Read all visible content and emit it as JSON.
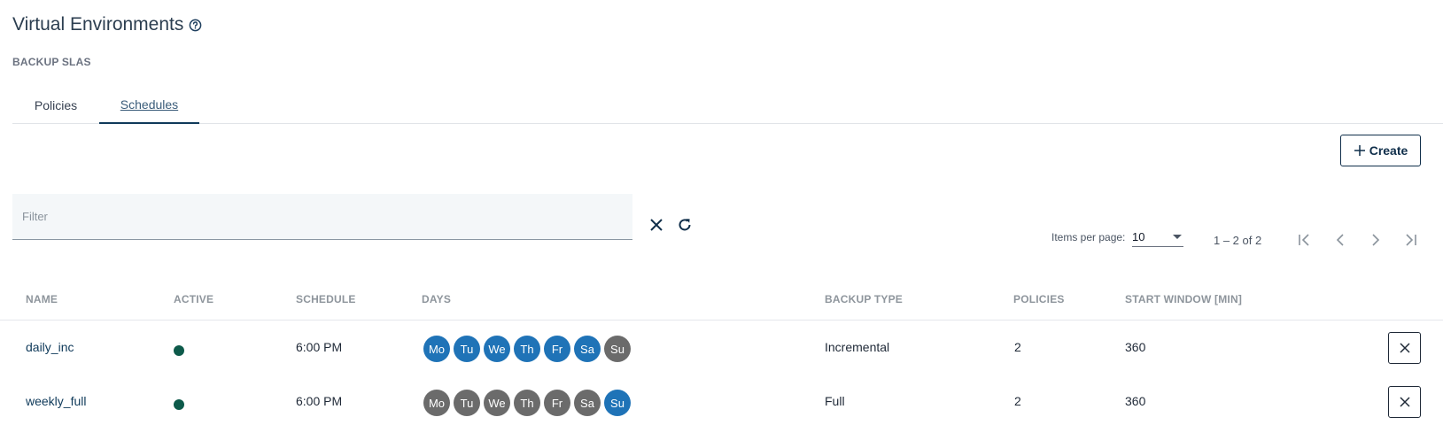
{
  "page": {
    "title": "Virtual Environments",
    "subtitle": "BACKUP SLAS"
  },
  "tabs": [
    {
      "label": "Policies",
      "active": false
    },
    {
      "label": "Schedules",
      "active": true
    }
  ],
  "toolbar": {
    "create_label": "Create"
  },
  "filter": {
    "placeholder": "Filter",
    "value": ""
  },
  "pagination": {
    "items_per_page_label": "Items per page:",
    "items_per_page": "10",
    "range": "1 – 2 of 2"
  },
  "table": {
    "columns": [
      "NAME",
      "ACTIVE",
      "SCHEDULE",
      "DAYS",
      "BACKUP TYPE",
      "POLICIES",
      "START WINDOW [MIN]"
    ],
    "day_labels": [
      "Mo",
      "Tu",
      "We",
      "Th",
      "Fr",
      "Sa",
      "Su"
    ],
    "rows": [
      {
        "name": "daily_inc",
        "active": true,
        "schedule": "6:00 PM",
        "days_on": [
          true,
          true,
          true,
          true,
          true,
          true,
          false
        ],
        "backup_type": "Incremental",
        "policies": "2",
        "start_window": "360"
      },
      {
        "name": "weekly_full",
        "active": true,
        "schedule": "6:00 PM",
        "days_on": [
          false,
          false,
          false,
          false,
          false,
          false,
          true
        ],
        "backup_type": "Full",
        "policies": "2",
        "start_window": "360"
      }
    ]
  },
  "colors": {
    "accent": "#0f3a5a",
    "day_on": "#1f73b7",
    "day_off": "#6b6b6b",
    "active_dot": "#0d5a4a"
  },
  "icons": {
    "help": "help-circle-icon",
    "plus": "plus-icon",
    "clear": "close-icon",
    "refresh": "refresh-icon",
    "dropdown": "caret-down-icon",
    "first_page": "first-page-icon",
    "prev_page": "chevron-left-icon",
    "next_page": "chevron-right-icon",
    "last_page": "last-page-icon",
    "delete": "close-icon"
  }
}
